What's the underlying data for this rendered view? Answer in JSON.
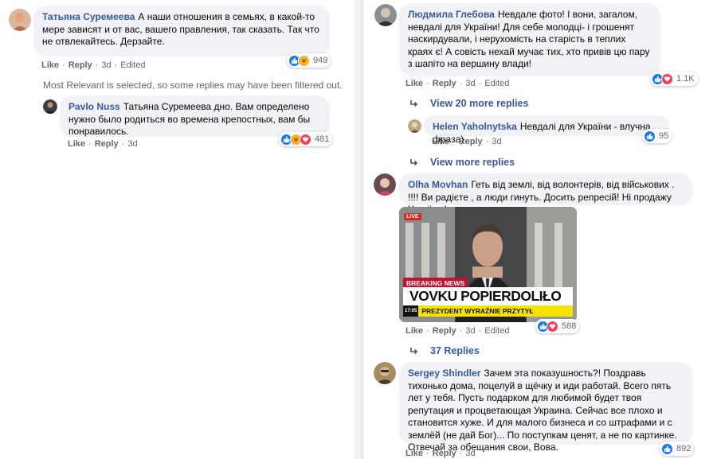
{
  "colors": {
    "like": "#1877f2",
    "love": "#f33e58",
    "haha": "#f7b125",
    "link": "#385898",
    "meta": "#65676b"
  },
  "actions": {
    "like": "Like",
    "reply": "Reply",
    "edited": "Edited"
  },
  "left": {
    "c1": {
      "author": "Татьяна Суремеева",
      "text": "А наши отношения в семьях, в какой-то мере зависят и от вас, вашего правления, так сказать. Так что не отвлекайтесь. Дерзайте.",
      "time": "3d",
      "reactions": [
        "like-icon",
        "haha-icon"
      ],
      "count": "949"
    },
    "filter_note": "Most Relevant is selected, so some replies may have been filtered out.",
    "c2": {
      "author": "Pavlo Nuss",
      "text": "Татьяна Суремеева дно. Вам определено нужно было родиться во времена крепостных, вам бы понравилось.",
      "time": "3d",
      "reactions": [
        "like-icon",
        "haha-icon",
        "love-icon"
      ],
      "count": "481"
    }
  },
  "right": {
    "c1": {
      "author": "Людмила Глебова",
      "text": "Невдале фото! І вони, загалом, невдалі для України! Для себе молодці- і грошенят наскирдували, і нерухомість на старість в теплих краях є! А совість нехай мучає тих, хто привів цю пару з шапіто на вершину влади!",
      "time": "3d",
      "reactions": [
        "like-icon",
        "love-icon"
      ],
      "count": "1.1K"
    },
    "more1": "View 20 more replies",
    "c2": {
      "author": "Helen Yaholnytska",
      "text": "Невдалі для України - влучна фраза)",
      "time": "3d",
      "reactions": [
        "like-icon"
      ],
      "count": "95"
    },
    "more2": "View more replies",
    "c3": {
      "author": "Olha Movhan",
      "text": "Геть від землі, від волонтерів, від військових . !!!! Ви радієте , а люди гинуть. Досить репресій! Ні продажу України !",
      "time": "3d",
      "reactions": [
        "like-icon",
        "love-icon"
      ],
      "count": "588",
      "image": {
        "live": "LIVE",
        "breaking": "BREAKING NEWS",
        "headline": "VOVKU POPIERDOLIŁO",
        "sub": "PREZYDENT WYRAŹNIE PRZYTYŁ",
        "clock": "17:05"
      }
    },
    "more3": "37 Replies",
    "c4": {
      "author": "Sergey Shindler",
      "text": "Зачем эта показушность?! Поздравь тихонько дома, поцелуй в щёчку и иди работай. Всего пять лет у тебя. Пусть подарком для любимой будет твоя репутация и процветающая Украина. Сейчас все плохо и становится хуже. И для малого бизнеса и со штрафами и с землёй (не дай Бог)... По поступкам ценят, а не по картинке. Отвечай за обещания свои, Вова.",
      "time": "3d",
      "reactions": [
        "like-icon"
      ],
      "count": "892"
    }
  }
}
